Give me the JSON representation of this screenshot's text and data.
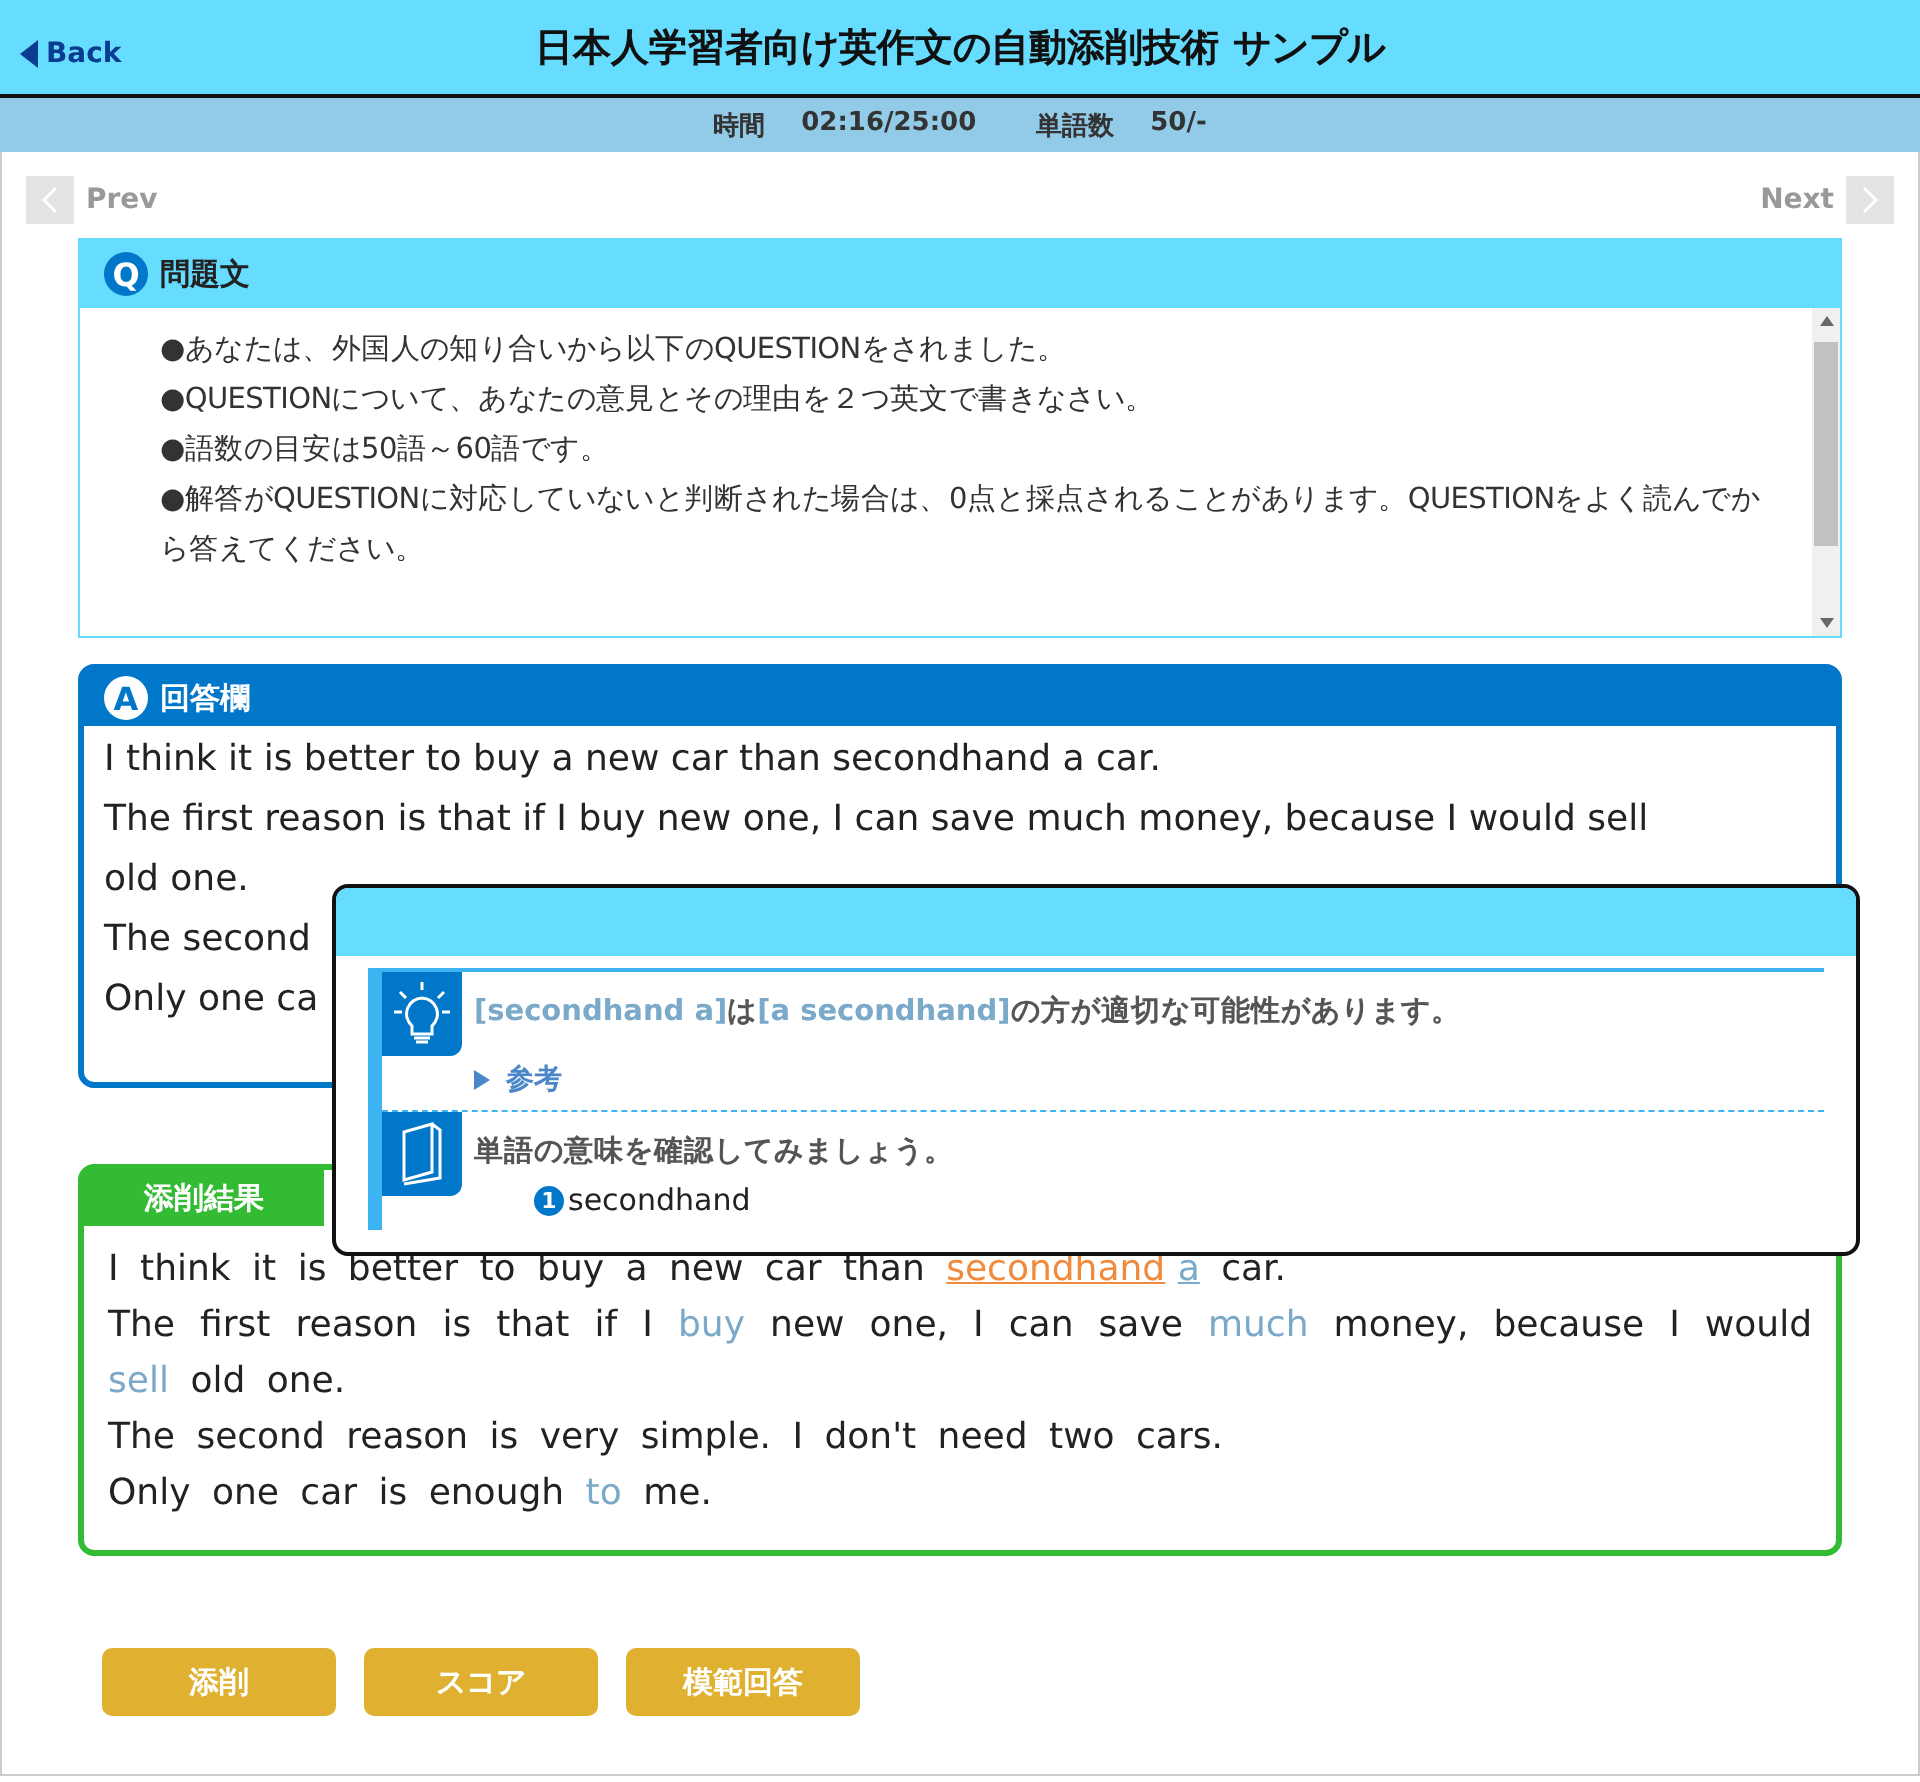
{
  "header": {
    "back": "Back",
    "title": "日本人学習者向け英作文の自動添削技術 サンプル"
  },
  "status_bar": [
    {
      "label": "時間",
      "value": "02:16/25:00"
    },
    {
      "label": "単語数",
      "value": "50/-"
    }
  ],
  "nav": {
    "prev": {
      "label": "Prev",
      "disabled": true
    },
    "next": {
      "label": "Next",
      "disabled": true
    }
  },
  "question": {
    "badge": "Q",
    "title": "問題文",
    "lines": [
      "●あなたは、外国人の知り合いから以下のQUESTIONをされました。",
      "●QUESTIONについて、あなたの意見とその理由を２つ英文で書きなさい。",
      "●語数の目安は50語～60語です。",
      "●解答がQUESTIONに対応していないと判断された場合は、0点と採点されることがあります。QUESTIONをよく読んでから答えてください。"
    ]
  },
  "answer": {
    "badge": "A",
    "title": "回答欄",
    "lines": [
      "I think it is better to buy a new car than secondhand a car.",
      "The first reason is that if I buy new one, I can save much money, because I would sell old one.",
      "The second",
      "Only one ca"
    ]
  },
  "correction": {
    "title": "添削結果",
    "lines": [
      [
        {
          "text": "I think it is better to buy a new car than ",
          "kind": "plain"
        },
        {
          "text": "secondhand",
          "kind": "error"
        },
        {
          "text": "a",
          "kind": "hint"
        },
        {
          "text": " car.",
          "kind": "plain"
        }
      ],
      [
        {
          "text": "The first reason is that if I ",
          "kind": "plain"
        },
        {
          "text": "buy",
          "kind": "note"
        },
        {
          "text": " new one, I can save ",
          "kind": "plain"
        },
        {
          "text": "much",
          "kind": "note"
        },
        {
          "text": " money, because I would ",
          "kind": "plain"
        },
        {
          "text": "sell",
          "kind": "note"
        },
        {
          "text": " old one.",
          "kind": "plain"
        }
      ],
      [
        {
          "text": "The second reason is very simple. I don't need two cars.",
          "kind": "plain"
        }
      ],
      [
        {
          "text": "Only one car is enough ",
          "kind": "plain"
        },
        {
          "text": "to",
          "kind": "note"
        },
        {
          "text": " me.",
          "kind": "plain"
        }
      ]
    ]
  },
  "popup": {
    "items": [
      {
        "kind": "hint",
        "message": "**[secondhand a]**は**[a secondhand]**の方が適切な可能性があります。",
        "link": "参考"
      },
      {
        "kind": "dictionary",
        "message": "単語の意味を確認してみましょう。",
        "words": [
          {
            "number": "1",
            "word": "secondhand"
          }
        ]
      }
    ]
  },
  "buttons": [
    "添削",
    "スコア",
    "模範回答"
  ]
}
